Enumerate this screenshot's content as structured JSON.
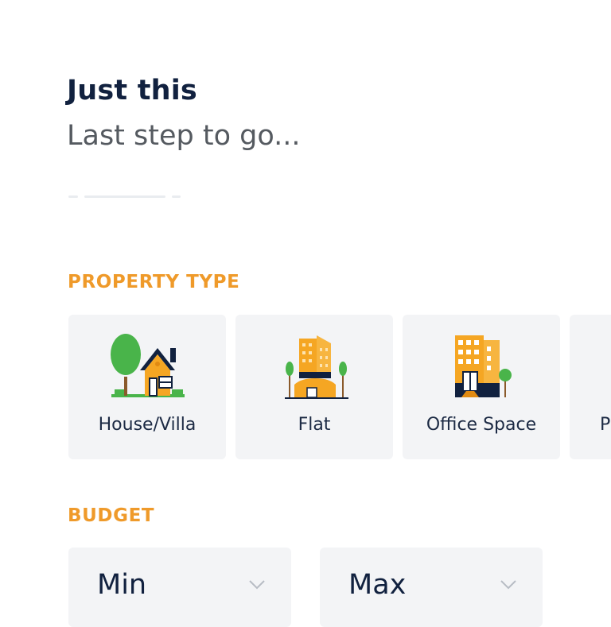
{
  "header": {
    "title": "Just this",
    "subtitle": "Last step to go..."
  },
  "progress": {
    "current_step": 2,
    "total_steps": 3
  },
  "property_type": {
    "label": "PROPERTY TYPE",
    "options": [
      {
        "label": "House/Villa",
        "icon": "house-icon"
      },
      {
        "label": "Flat",
        "icon": "apartment-building-icon"
      },
      {
        "label": "Office Space",
        "icon": "office-building-icon"
      },
      {
        "label": "P",
        "icon": ""
      }
    ]
  },
  "budget": {
    "label": "BUDGET",
    "min": {
      "label": "Min",
      "icon": "chevron-down-icon"
    },
    "max": {
      "label": "Max",
      "icon": "chevron-down-icon"
    }
  },
  "colors": {
    "heading": "#11213f",
    "accent_orange": "#ef9a2a",
    "card_bg": "#f3f4f6",
    "tree_green": "#49b44a",
    "building_orange": "#f5a623"
  }
}
